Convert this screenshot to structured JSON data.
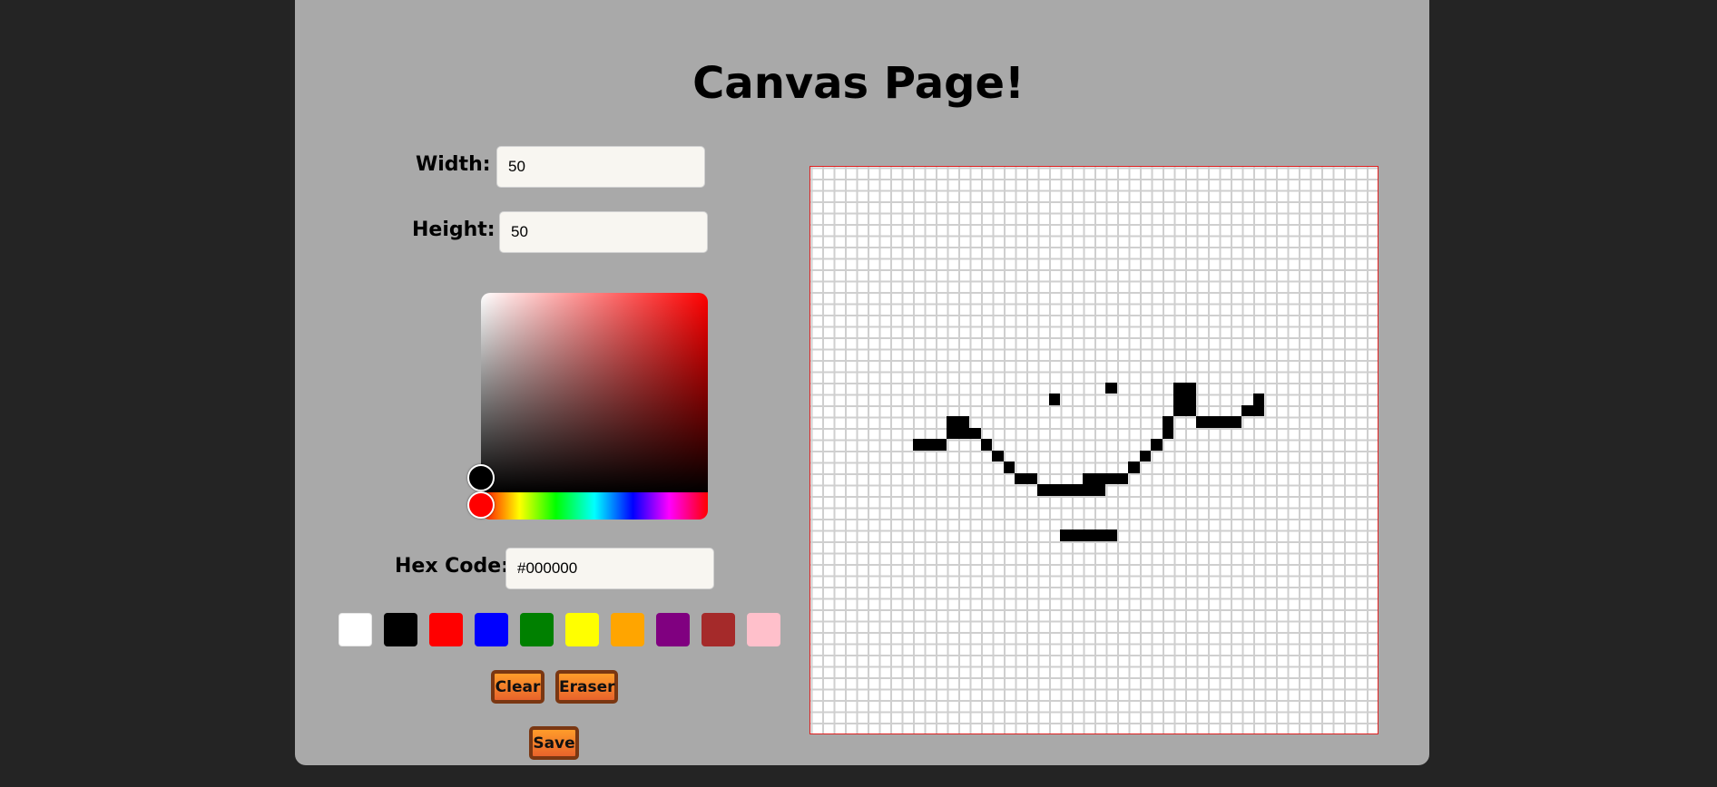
{
  "page": {
    "title": "Canvas Page!"
  },
  "controls": {
    "width_label": "Width:",
    "width_value": "50",
    "height_label": "Height:",
    "height_value": "50",
    "hex_label": "Hex Code:",
    "hex_value": "#000000"
  },
  "color_picker": {
    "selected_color": "#000000",
    "hue_color": "#ff0000"
  },
  "swatches": [
    {
      "name": "white",
      "color": "#ffffff"
    },
    {
      "name": "black",
      "color": "#000000"
    },
    {
      "name": "red",
      "color": "#ff0000"
    },
    {
      "name": "blue",
      "color": "#0000ff"
    },
    {
      "name": "green",
      "color": "#008000"
    },
    {
      "name": "yellow",
      "color": "#ffff00"
    },
    {
      "name": "orange",
      "color": "#ffa500"
    },
    {
      "name": "purple",
      "color": "#800080"
    },
    {
      "name": "brown",
      "color": "#a52a2a"
    },
    {
      "name": "pink",
      "color": "#ffc0cb"
    }
  ],
  "buttons": {
    "clear": "Clear",
    "eraser": "Eraser",
    "save": "Save"
  },
  "canvas": {
    "border_color": "#e02020",
    "pixel_color": "#000000"
  }
}
